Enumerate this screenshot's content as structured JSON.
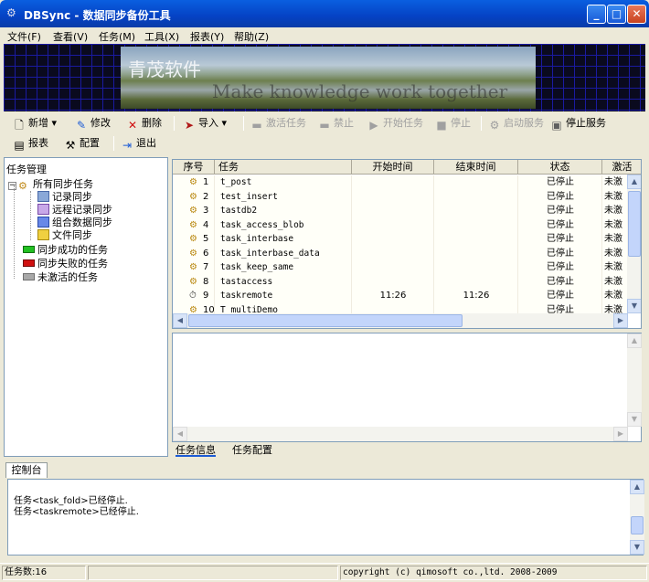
{
  "window": {
    "title": "DBSync - 数据同步备份工具",
    "app_icon": "gear-icon"
  },
  "menu": [
    "文件(F)",
    "查看(V)",
    "任务(M)",
    "工具(X)",
    "报表(Y)",
    "帮助(Z)"
  ],
  "banner": {
    "title": "青茂软件",
    "slogan": "Make knowledge work together"
  },
  "toolbar1": {
    "new": "新增",
    "edit": "修改",
    "delete": "删除",
    "import": "导入",
    "activate": "激活任务",
    "disable": "禁止",
    "start": "开始任务",
    "stop": "停止",
    "start_service": "启动服务",
    "stop_service": "停止服务"
  },
  "toolbar2": {
    "report": "报表",
    "config": "配置",
    "exit": "退出"
  },
  "left": {
    "header": "任务管理",
    "root": "所有同步任务",
    "children": [
      "记录同步",
      "远程记录同步",
      "组合数据同步",
      "文件同步"
    ],
    "success": "同步成功的任务",
    "failed": "同步失败的任务",
    "inactive": "未激活的任务"
  },
  "grid": {
    "columns": [
      "序号",
      "任务",
      "开始时间",
      "结束时间",
      "状态",
      "激活"
    ],
    "rows": [
      {
        "no": "1",
        "task": "t_post",
        "start": "",
        "end": "",
        "status": "已停止",
        "active": "未激"
      },
      {
        "no": "2",
        "task": "test_insert",
        "start": "",
        "end": "",
        "status": "已停止",
        "active": "未激"
      },
      {
        "no": "3",
        "task": "tastdb2",
        "start": "",
        "end": "",
        "status": "已停止",
        "active": "未激"
      },
      {
        "no": "4",
        "task": "task_access_blob",
        "start": "",
        "end": "",
        "status": "已停止",
        "active": "未激"
      },
      {
        "no": "5",
        "task": "task_interbase",
        "start": "",
        "end": "",
        "status": "已停止",
        "active": "未激"
      },
      {
        "no": "6",
        "task": "task_interbase_data",
        "start": "",
        "end": "",
        "status": "已停止",
        "active": "未激"
      },
      {
        "no": "7",
        "task": "task_keep_same",
        "start": "",
        "end": "",
        "status": "已停止",
        "active": "未激"
      },
      {
        "no": "8",
        "task": "tastaccess",
        "start": "",
        "end": "",
        "status": "已停止",
        "active": "未激"
      },
      {
        "no": "9",
        "task": "taskremote",
        "start": "11:26",
        "end": "11:26",
        "status": "已停止",
        "active": "未激"
      },
      {
        "no": "10",
        "task": "T_multiDemo",
        "start": "",
        "end": "",
        "status": "已停止",
        "active": "未激"
      }
    ]
  },
  "tabs": [
    "任务信息",
    "任务配置"
  ],
  "console": {
    "tab": "控制台",
    "lines": [
      "任务<task_fold>已经停止.",
      "任务<taskremote>已经停止."
    ]
  },
  "status": {
    "count": "任务数:16",
    "copyright": "copyright (c) qimosoft co.,ltd. 2008-2009"
  },
  "colors": {
    "title_bar": "#0a5fe0",
    "selection_header": "#ece9d8",
    "success": "#22c022",
    "failed": "#d01010",
    "inactive": "#a0a0a0"
  }
}
